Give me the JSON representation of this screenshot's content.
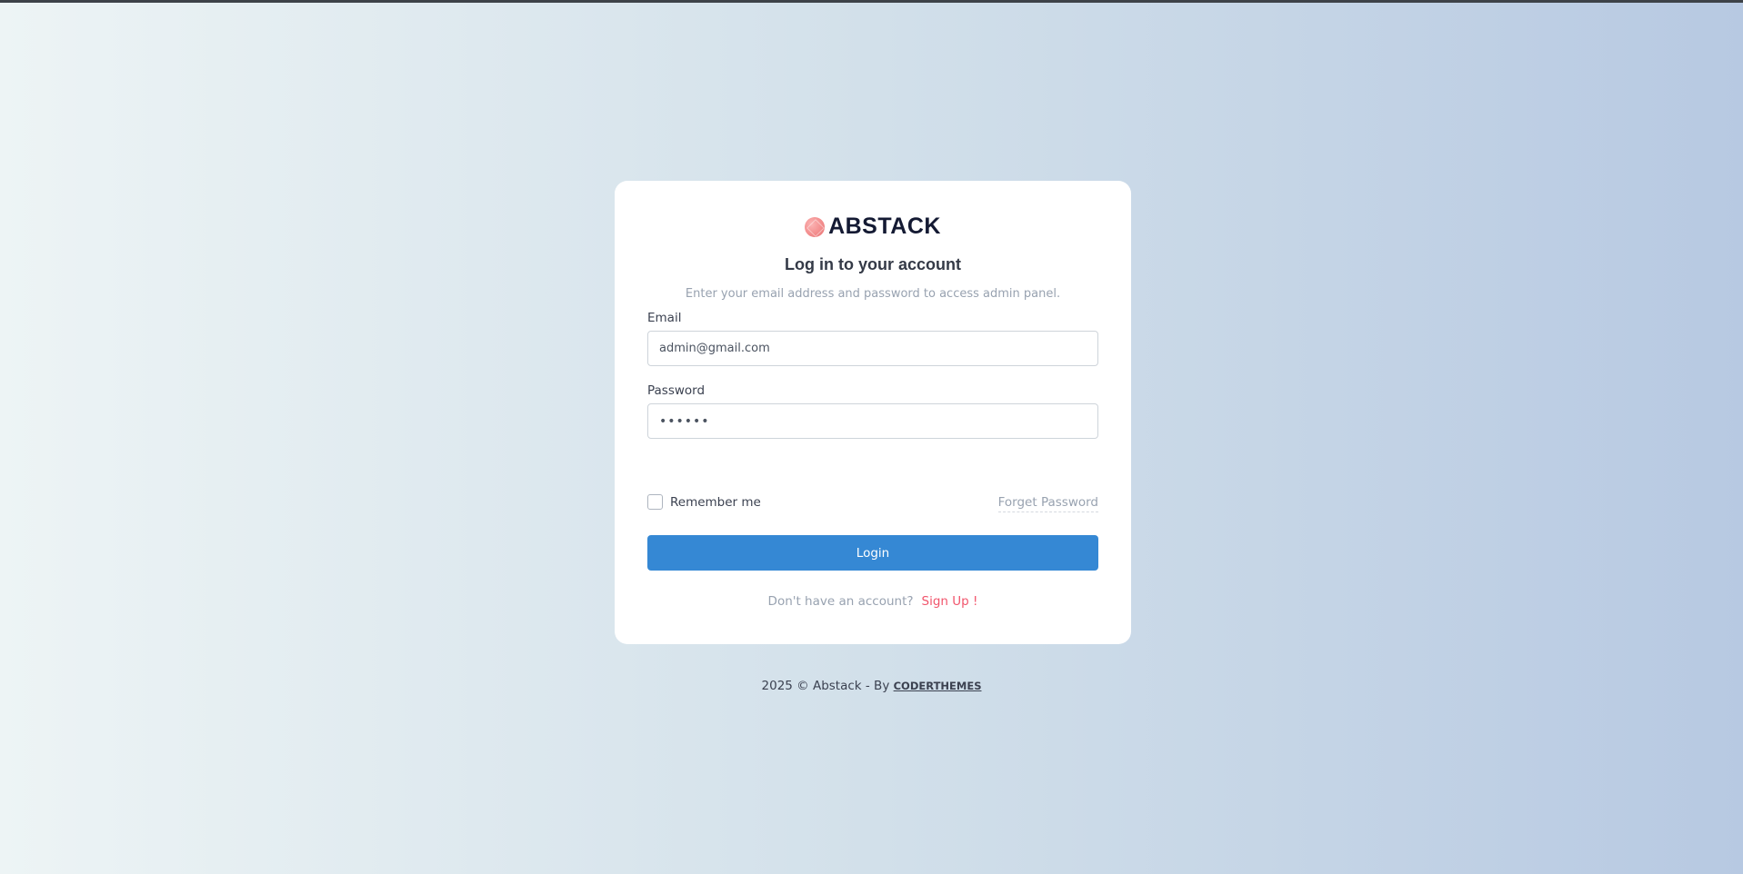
{
  "brand": {
    "name": "ABSTACK",
    "logo_icon": "gem-icon",
    "logo_color": "#f38d8d"
  },
  "login": {
    "title": "Log in to your account",
    "subtitle": "Enter your email address and password to access admin panel.",
    "email_label": "Email",
    "email_value": "admin@gmail.com",
    "password_label": "Password",
    "password_value": "••••••",
    "remember_label": "Remember me",
    "remember_checked": false,
    "forget_label": "Forget Password",
    "login_button": "Login",
    "signup_question": "Don't have an account?",
    "signup_link": "Sign Up !"
  },
  "footer": {
    "text": "2025 © Abstack - By",
    "link": "CODERTHEMES"
  },
  "colors": {
    "primary": "#3588d4",
    "danger": "#f1556c",
    "muted": "#98a2b0"
  }
}
